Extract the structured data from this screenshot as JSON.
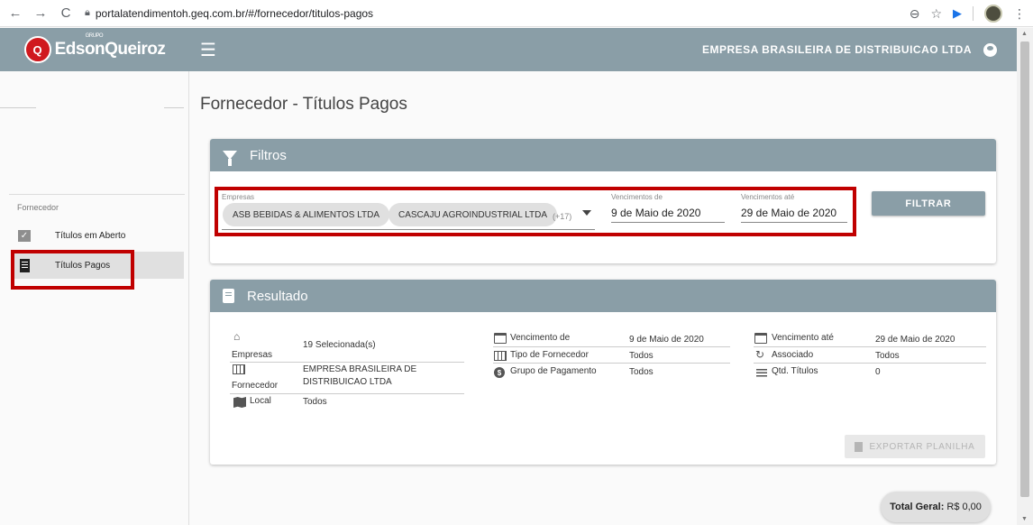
{
  "browser": {
    "back": "←",
    "forward": "→",
    "reload": "C",
    "url": "portalatendimentoh.geq.com.br/#/fornecedor/titulos-pagos"
  },
  "header": {
    "logo_text": "EdsonQueiroz",
    "logo_sup": "GRUPO",
    "company": "EMPRESA BRASILEIRA DE DISTRIBUICAO LTDA"
  },
  "sidebar": {
    "section": "Fornecedor",
    "items": [
      {
        "label": "Títulos em Aberto",
        "icon": "check-box-icon"
      },
      {
        "label": "Títulos Pagos",
        "icon": "receipt-icon",
        "active": true
      }
    ]
  },
  "page": {
    "title": "Fornecedor - Títulos Pagos"
  },
  "filters": {
    "title": "Filtros",
    "empresas_label": "Empresas",
    "chips": [
      "ASB BEBIDAS & ALIMENTOS LTDA",
      "CASCAJU AGROINDUSTRIAL LTDA"
    ],
    "more": "(+17)",
    "venc_de_label": "Vencimentos de",
    "venc_de_value": "9 de Maio de 2020",
    "venc_ate_label": "Vencimentos até",
    "venc_ate_value": "29 de Maio de 2020",
    "button": "FILTRAR"
  },
  "results": {
    "title": "Resultado",
    "empresas_label": "Empresas",
    "empresas_value": "19 Selecionada(s)",
    "fornecedor_label": "Fornecedor",
    "fornecedor_value_1": "EMPRESA BRASILEIRA DE",
    "fornecedor_value_2": "DISTRIBUICAO LTDA",
    "local_label": "Local",
    "local_value": "Todos",
    "venc_de_label": "Vencimento de",
    "venc_de_value": "9 de Maio de 2020",
    "tipo_label": "Tipo de Fornecedor",
    "tipo_value": "Todos",
    "grupo_label": "Grupo de Pagamento",
    "grupo_value": "Todos",
    "venc_ate_label": "Vencimento até",
    "venc_ate_value": "29 de Maio de 2020",
    "associado_label": "Associado",
    "associado_value": "Todos",
    "qtd_label": "Qtd. Títulos",
    "qtd_value": "0",
    "export_button": "EXPORTAR PLANILHA"
  },
  "total": {
    "label": "Total Geral:",
    "value": "R$ 0,00"
  },
  "colors": {
    "header": "#8a9ea7",
    "highlight_border": "#c00000",
    "logo_red": "#d0191e"
  }
}
